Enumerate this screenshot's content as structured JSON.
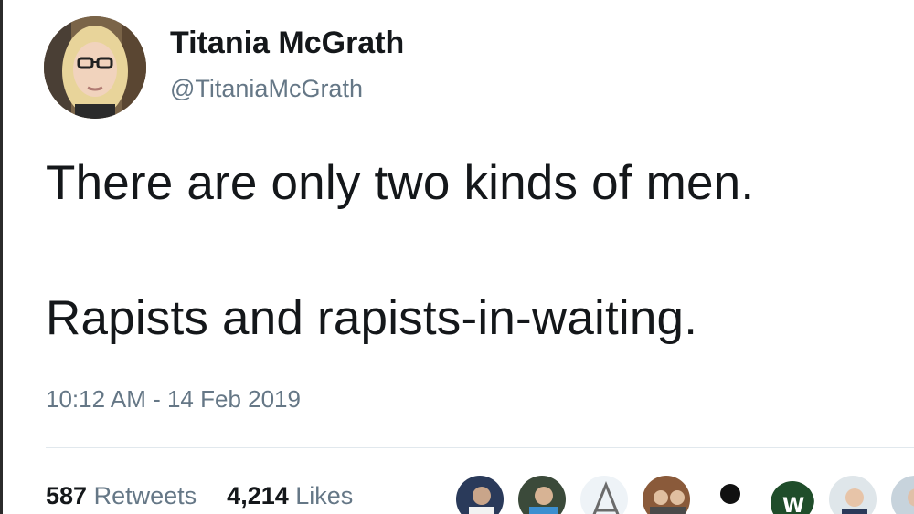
{
  "tweet": {
    "author": {
      "name": "Titania McGrath",
      "handle": "@TitaniaMcGrath"
    },
    "text_lines": [
      "There are only two kinds of men.",
      "Rapists and rapists-in-waiting."
    ],
    "timestamp": "10:12 AM - 14 Feb 2019",
    "stats": {
      "retweets_count": "587",
      "retweets_label": "Retweets",
      "likes_count": "4,214",
      "likes_label": "Likes"
    }
  },
  "icons": {
    "author_avatar": "avatar-photo",
    "likers": [
      "liker-avatar",
      "liker-avatar",
      "liker-avatar",
      "liker-avatar",
      "default-silhouette-avatar",
      "liker-avatar",
      "liker-avatar",
      "liker-avatar"
    ]
  }
}
